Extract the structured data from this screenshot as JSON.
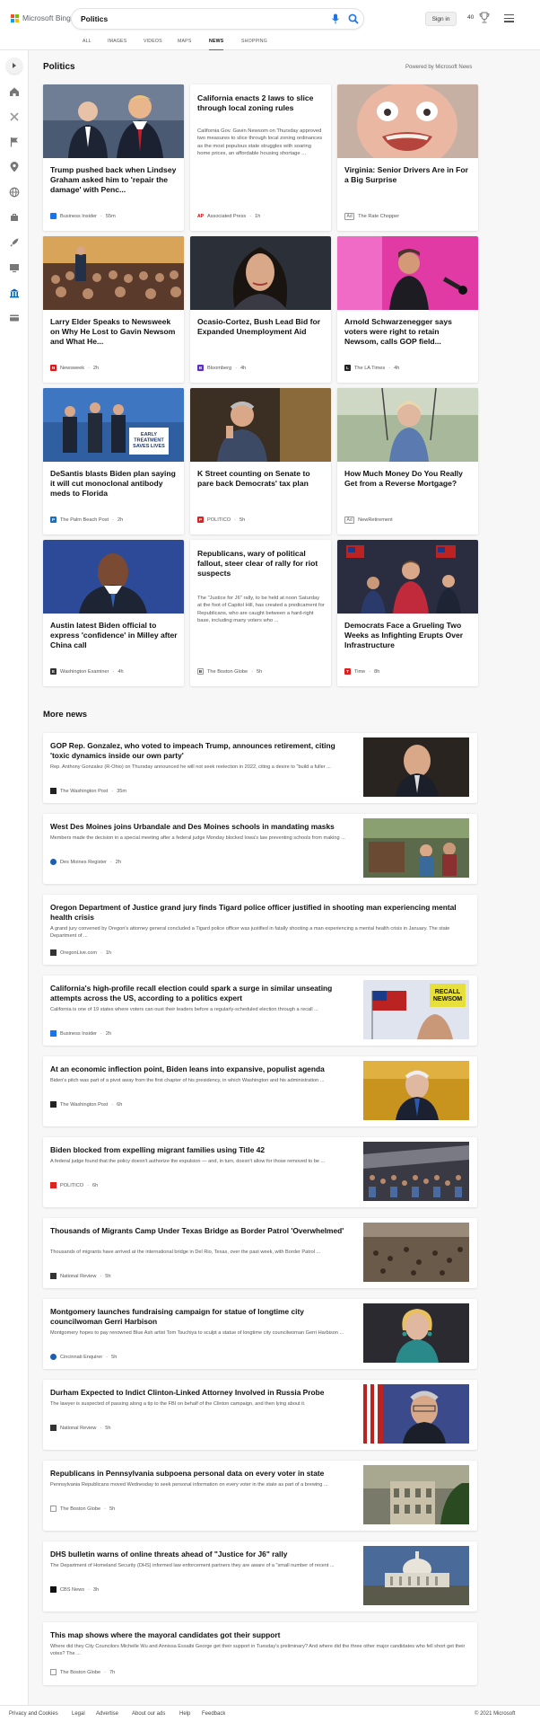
{
  "header": {
    "logo_text": "Microsoft Bing",
    "search_value": "Politics",
    "signin_label": "Sign in",
    "rewards_points": "40"
  },
  "nav": {
    "tabs": [
      "ALL",
      "IMAGES",
      "VIDEOS",
      "MAPS",
      "NEWS",
      "SHOPPING"
    ],
    "active": "NEWS"
  },
  "section": {
    "title": "Politics",
    "powered_by": "Powered by Microsoft News"
  },
  "cards": [
    {
      "title": "Trump pushed back when Lindsey Graham asked him to 'repair the damage' with Penc...",
      "source": "Business Insider",
      "time": "55m"
    },
    {
      "title": "California enacts 2 laws to slice through local zoning rules",
      "snippet": "California Gov. Gavin Newsom on Thursday approved two measures to slice through local zoning ordinances as the most populous state struggles with soaring home prices, an affordable housing shortage ...",
      "source": "Associated Press",
      "time": "1h"
    },
    {
      "title": "Virginia: Senior Drivers Are in For a Big Surprise",
      "ad": "Ad",
      "source": "The Rate Chopper",
      "time": ""
    },
    {
      "title": "Larry Elder Speaks to Newsweek on Why He Lost to Gavin Newsom and What He...",
      "source": "Newsweek",
      "time": "2h"
    },
    {
      "title": "Ocasio-Cortez, Bush Lead Bid for Expanded Unemployment Aid",
      "source": "Bloomberg",
      "time": "4h"
    },
    {
      "title": "Arnold Schwarzenegger says voters were right to retain Newsom, calls GOP field...",
      "source": "The LA Times",
      "time": "4h"
    },
    {
      "title": "DeSantis blasts Biden plan saying it will cut monoclonal antibody meds to Florida",
      "source": "The Palm Beach Post",
      "time": "2h",
      "sign_text": "EARLY TREATMENT SAVES LIVES"
    },
    {
      "title": "K Street counting on Senate to pare back Democrats' tax plan",
      "source": "POLITICO",
      "time": "5h"
    },
    {
      "title": "How Much Money Do You Really Get from a Reverse Mortgage?",
      "ad": "Ad",
      "source": "NewRetirement",
      "time": ""
    },
    {
      "title": "Austin latest Biden official to express 'confidence' in Milley after China call",
      "source": "Washington Examiner",
      "time": "4h"
    },
    {
      "title": "Republicans, wary of political fallout, steer clear of rally for riot suspects",
      "snippet": "The \"Justice for J6\" rally, to be held at noon Saturday at the foot of Capitol Hill, has created a predicament for Republicans, who are caught between a hard-right base, including many voters who ...",
      "source": "The Boston Globe",
      "time": "5h"
    },
    {
      "title": "Democrats Face a Grueling Two Weeks as Infighting Erupts Over Infrastructure",
      "source": "Time",
      "time": "8h"
    }
  ],
  "more_news": {
    "title": "More news",
    "items": [
      {
        "title": "GOP Rep. Gonzalez, who voted to impeach Trump, announces retirement, citing 'toxic dynamics inside our own party'",
        "snippet": "Rep. Anthony Gonzalez (R-Ohio) on Thursday announced he will not seek reelection in 2022, citing a desire to \"build a fuller ...",
        "source": "The Washington Post",
        "time": "35m"
      },
      {
        "title": "West Des Moines joins Urbandale and Des Moines schools in mandating masks",
        "snippet": "Members made the decision in a special meeting after a federal judge Monday blocked Iowa's law preventing schools from making ...",
        "source": "Des Moines Register",
        "time": "2h"
      },
      {
        "title": "Oregon Department of Justice grand jury finds Tigard police officer justified in shooting man experiencing mental health crisis",
        "snippet": "A grand jury convened by Oregon's attorney general concluded a Tigard police officer was justified in fatally shooting a man experiencing a mental health crisis in January. The state Department of ...",
        "source": "OregonLive.com",
        "time": "1h"
      },
      {
        "title": "California's high-profile recall election could spark a surge in similar unseating attempts across the US, according to a politics expert",
        "snippet": "California is one of 19 states where voters can oust their leaders before a regularly-scheduled election through a recall ...",
        "source": "Business Insider",
        "time": "2h",
        "sign_text": "RECALL NEWSOM"
      },
      {
        "title": "At an economic inflection point, Biden leans into expansive, populist agenda",
        "snippet": "Biden's pitch was part of a pivot away from the first chapter of his presidency, in which Washington and his administration ...",
        "source": "The Washington Post",
        "time": "6h"
      },
      {
        "title": "Biden blocked from expelling migrant families using Title 42",
        "snippet": "A federal judge found that the policy doesn't authorize the expulsion — and, in turn, doesn't allow for those removed to be ...",
        "source": "POLITICO",
        "time": "6h"
      },
      {
        "title": "Thousands of Migrants Camp Under Texas Bridge as Border Patrol 'Overwhelmed'",
        "snippet": "Thousands of migrants have arrived at the international bridge in Del Rio, Texas, over the past week, with Border Patrol ...",
        "source": "National Review",
        "time": "5h"
      },
      {
        "title": "Montgomery launches fundraising campaign for statue of longtime city councilwoman Gerri Harbison",
        "snippet": "Montgomery hopes to pay renowned Blue Ash artist Tom Tsuchiya to sculpt a statue of longtime city councilwoman Gerri Harbison ...",
        "source": "Cincinnati Enquirer",
        "time": "5h"
      },
      {
        "title": "Durham Expected to Indict Clinton-Linked Attorney Involved in Russia Probe",
        "snippet": "The lawyer is suspected of passing along a tip to the FBI on behalf of the Clinton campaign, and then lying about it.",
        "source": "National Review",
        "time": "5h"
      },
      {
        "title": "Republicans in Pennsylvania subpoena personal data on every voter in state",
        "snippet": "Pennsylvania Republicans moved Wednesday to seek personal information on every voter in the state as part of a brewing ...",
        "source": "The Boston Globe",
        "time": "5h"
      },
      {
        "title": "DHS bulletin warns of online threats ahead of \"Justice for J6\" rally",
        "snippet": "The Department of Homeland Security (DHS) informed law enforcement partners they are aware of a \"small number of recent ...",
        "source": "CBS News",
        "time": "3h"
      },
      {
        "title": "This map shows where the mayoral candidates got their support",
        "snippet": "Where did they City Councilors Michelle Wu and Annissa Essaibi George get their support in Tuesday's preliminary? And where did the three other major candidates who fell short get their votes? The ...",
        "source": "The Boston Globe",
        "time": "7h"
      }
    ]
  },
  "footer": {
    "links": [
      "Privacy and Cookies",
      "Legal",
      "Advertise",
      "About our ads",
      "Help",
      "Feedback"
    ],
    "copyright": "© 2021 Microsoft"
  },
  "icons": [
    "mic-icon",
    "search-icon",
    "trophy-icon",
    "menu-icon",
    "chevron-right-icon",
    "home-icon",
    "flag-icon",
    "location-icon",
    "globe-icon",
    "briefcase-icon",
    "rocket-icon",
    "tv-icon",
    "bank-icon",
    "card-icon"
  ],
  "colors": {
    "accent": "#1a73e8",
    "link_blue": "#0067b8"
  }
}
